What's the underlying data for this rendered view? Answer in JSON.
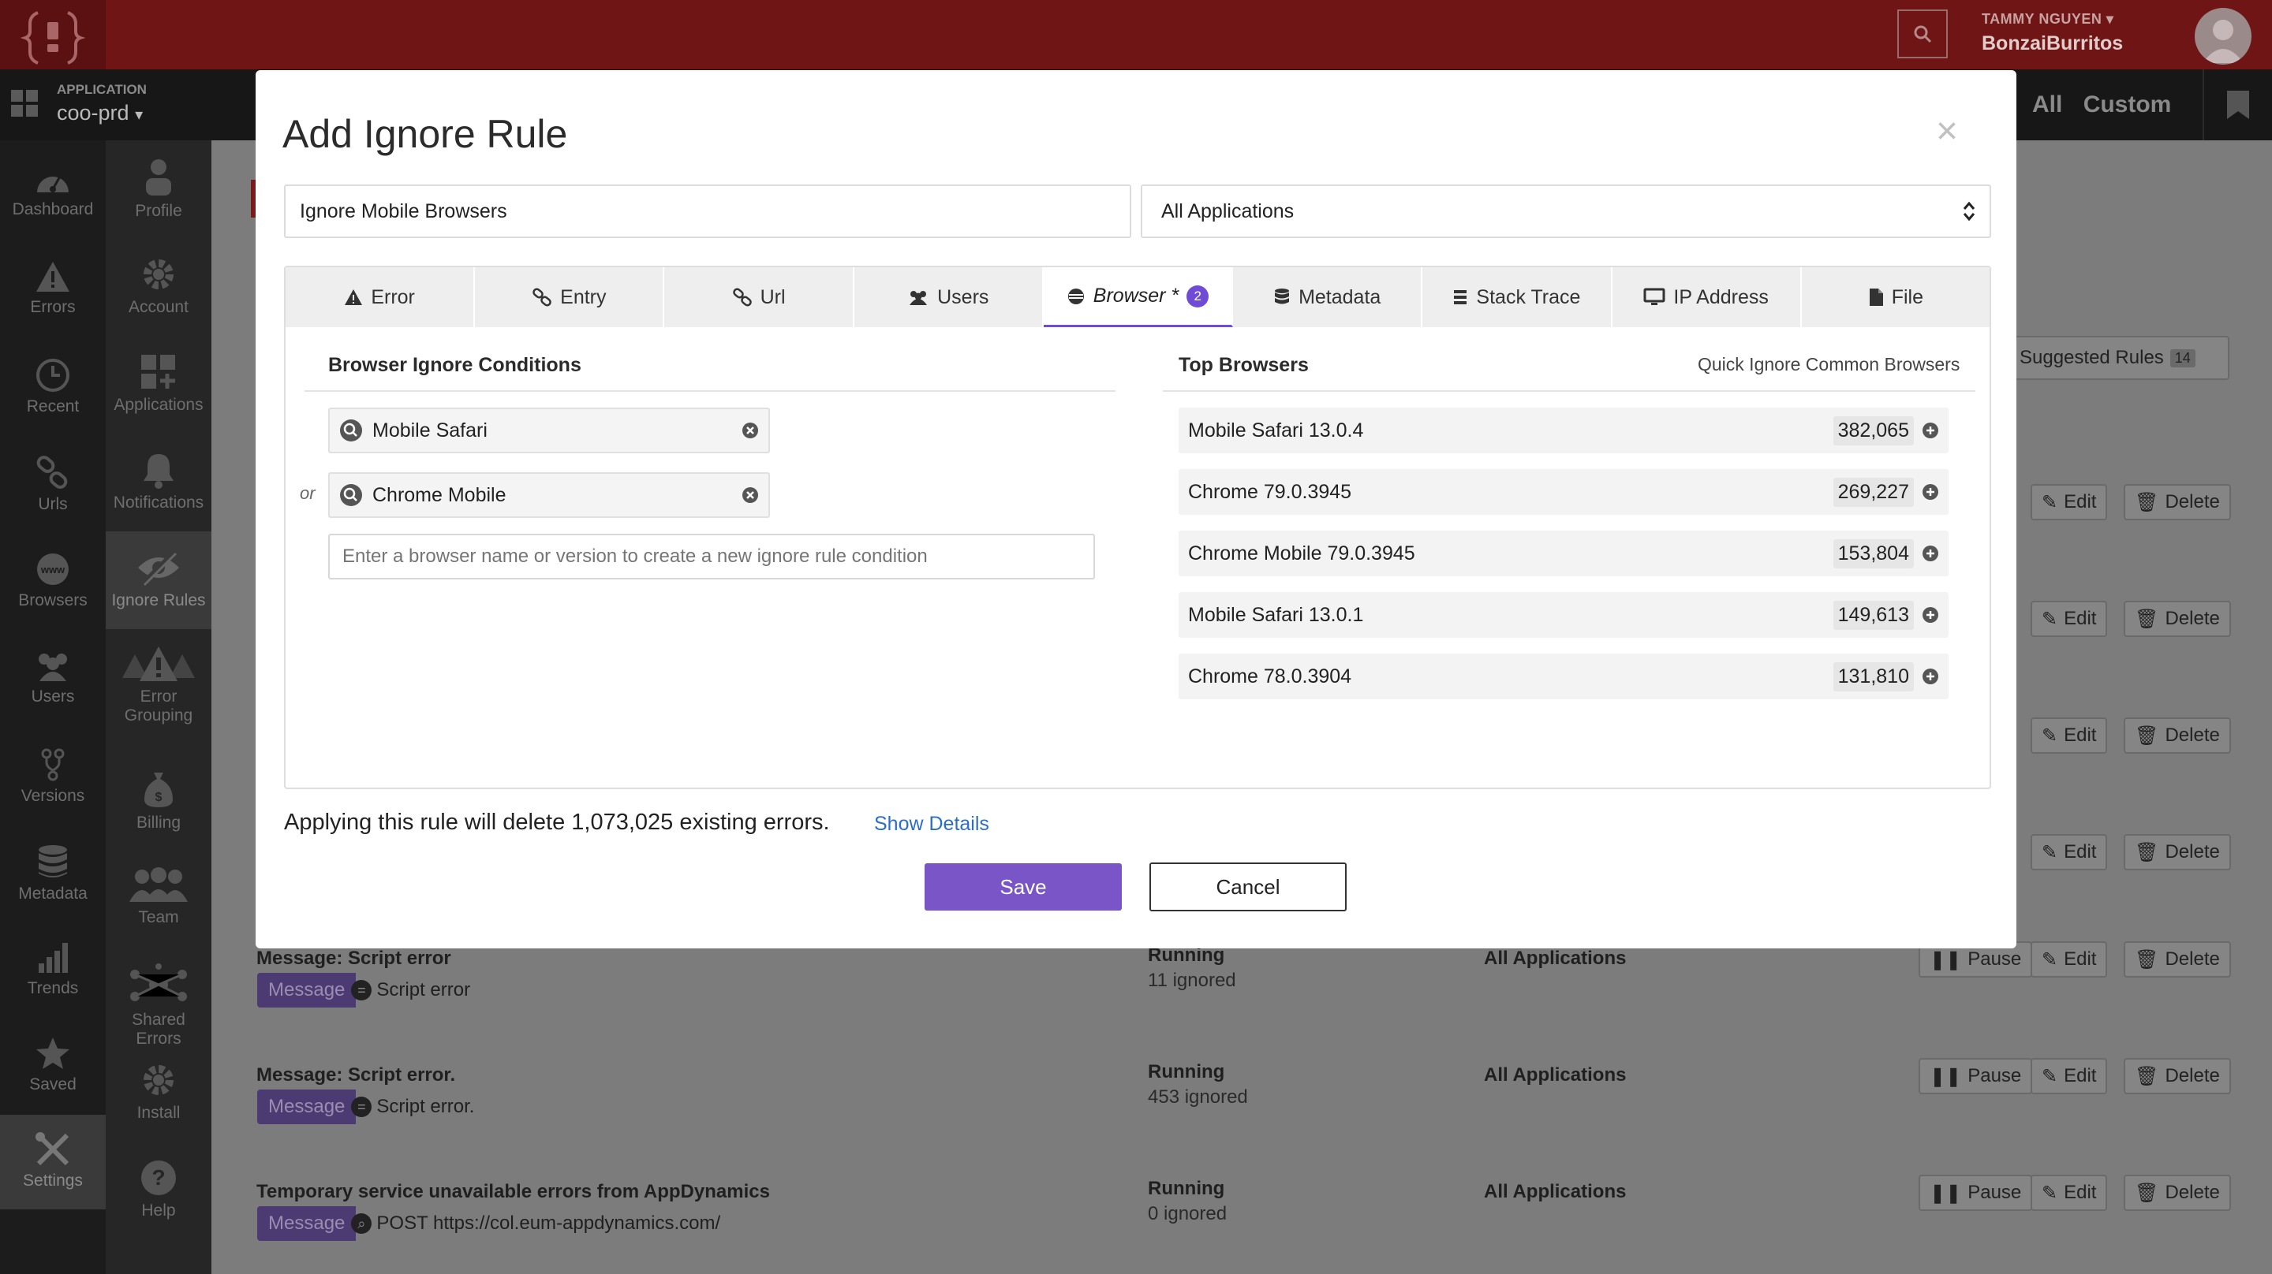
{
  "header": {
    "user_name": "TAMMY NGUYEN",
    "org_name": "BonzaiBurritos"
  },
  "app": {
    "label": "APPLICATION",
    "name": "coo-prd"
  },
  "scope": {
    "all": "All",
    "custom": "Custom"
  },
  "nav_primary": [
    {
      "label": "Dashboard",
      "icon": "dashboard-icon"
    },
    {
      "label": "Errors",
      "icon": "warning-icon"
    },
    {
      "label": "Recent",
      "icon": "clock-icon"
    },
    {
      "label": "Urls",
      "icon": "link-icon"
    },
    {
      "label": "Browsers",
      "icon": "www-icon"
    },
    {
      "label": "Users",
      "icon": "users-icon"
    },
    {
      "label": "Versions",
      "icon": "branch-icon"
    },
    {
      "label": "Metadata",
      "icon": "database-icon"
    },
    {
      "label": "Trends",
      "icon": "bar-chart-icon"
    },
    {
      "label": "Saved",
      "icon": "star-icon"
    },
    {
      "label": "Settings",
      "icon": "tools-icon"
    }
  ],
  "nav_secondary": [
    {
      "label": "Profile",
      "icon": "person-icon"
    },
    {
      "label": "Account",
      "icon": "gear-icon"
    },
    {
      "label": "Applications",
      "icon": "apps-grid-icon"
    },
    {
      "label": "Notifications",
      "icon": "bell-icon"
    },
    {
      "label": "Ignore Rules",
      "icon": "eye-slash-icon"
    },
    {
      "label": "Error Grouping",
      "icon": "warning-group-icon"
    },
    {
      "label": "Billing",
      "icon": "money-bag-icon"
    },
    {
      "label": "Team",
      "icon": "team-icon"
    },
    {
      "label": "Shared Errors",
      "icon": "share-icon"
    },
    {
      "label": "Install",
      "icon": "gear-icon"
    },
    {
      "label": "Help",
      "icon": "help-icon"
    }
  ],
  "suggested": {
    "label": "Suggested Rules",
    "count": "14"
  },
  "rules": [
    {
      "title": "Message: Script error",
      "tag": "Message",
      "op": "=",
      "value": "Script error",
      "status": "Running",
      "count": "11 ignored",
      "apps": "All Applications"
    },
    {
      "title": "Message: Script error.",
      "tag": "Message",
      "op": "=",
      "value": "Script error.",
      "status": "Running",
      "count": "453 ignored",
      "apps": "All Applications"
    },
    {
      "title": "Temporary service unavailable errors from AppDynamics",
      "tag": "Message",
      "op": "search",
      "value": "POST https://col.eum-appdynamics.com/",
      "status": "Running",
      "count": "0 ignored",
      "apps": "All Applications"
    }
  ],
  "row_actions": {
    "pause": "Pause",
    "edit": "Edit",
    "delete": "Delete"
  },
  "modal": {
    "title": "Add Ignore Rule",
    "close": "×",
    "rule_name": "Ignore Mobile Browsers",
    "app_select": "All Applications",
    "tabs": [
      {
        "label": "Error",
        "icon": "warning-icon"
      },
      {
        "label": "Entry",
        "icon": "link-icon"
      },
      {
        "label": "Url",
        "icon": "link-icon"
      },
      {
        "label": "Users",
        "icon": "users-icon"
      },
      {
        "label": "Browser *",
        "icon": "browser-icon",
        "badge": "2"
      },
      {
        "label": "Metadata",
        "icon": "database-icon"
      },
      {
        "label": "Stack Trace",
        "icon": "list-icon"
      },
      {
        "label": "IP Address",
        "icon": "monitor-icon"
      },
      {
        "label": "File",
        "icon": "file-icon"
      }
    ],
    "conditions_title": "Browser Ignore Conditions",
    "conditions": [
      "Mobile Safari",
      "Chrome Mobile"
    ],
    "or_label": "or",
    "new_condition_placeholder": "Enter a browser name or version to create a new ignore rule condition",
    "top_title": "Top Browsers",
    "quick_ignore": "Quick Ignore Common Browsers",
    "top_browsers": [
      {
        "name": "Mobile Safari 13.0.4",
        "count": "382,065"
      },
      {
        "name": "Chrome 79.0.3945",
        "count": "269,227"
      },
      {
        "name": "Chrome Mobile 79.0.3945",
        "count": "153,804"
      },
      {
        "name": "Mobile Safari 13.0.1",
        "count": "149,613"
      },
      {
        "name": "Chrome 78.0.3904",
        "count": "131,810"
      }
    ],
    "applying_text": "Applying this rule will delete 1,073,025 existing errors.",
    "show_details": "Show Details",
    "save": "Save",
    "cancel": "Cancel"
  },
  "colors": {
    "accent": "#6f4bd6",
    "topbar": "#6f1515",
    "link": "#2a6ec7"
  }
}
